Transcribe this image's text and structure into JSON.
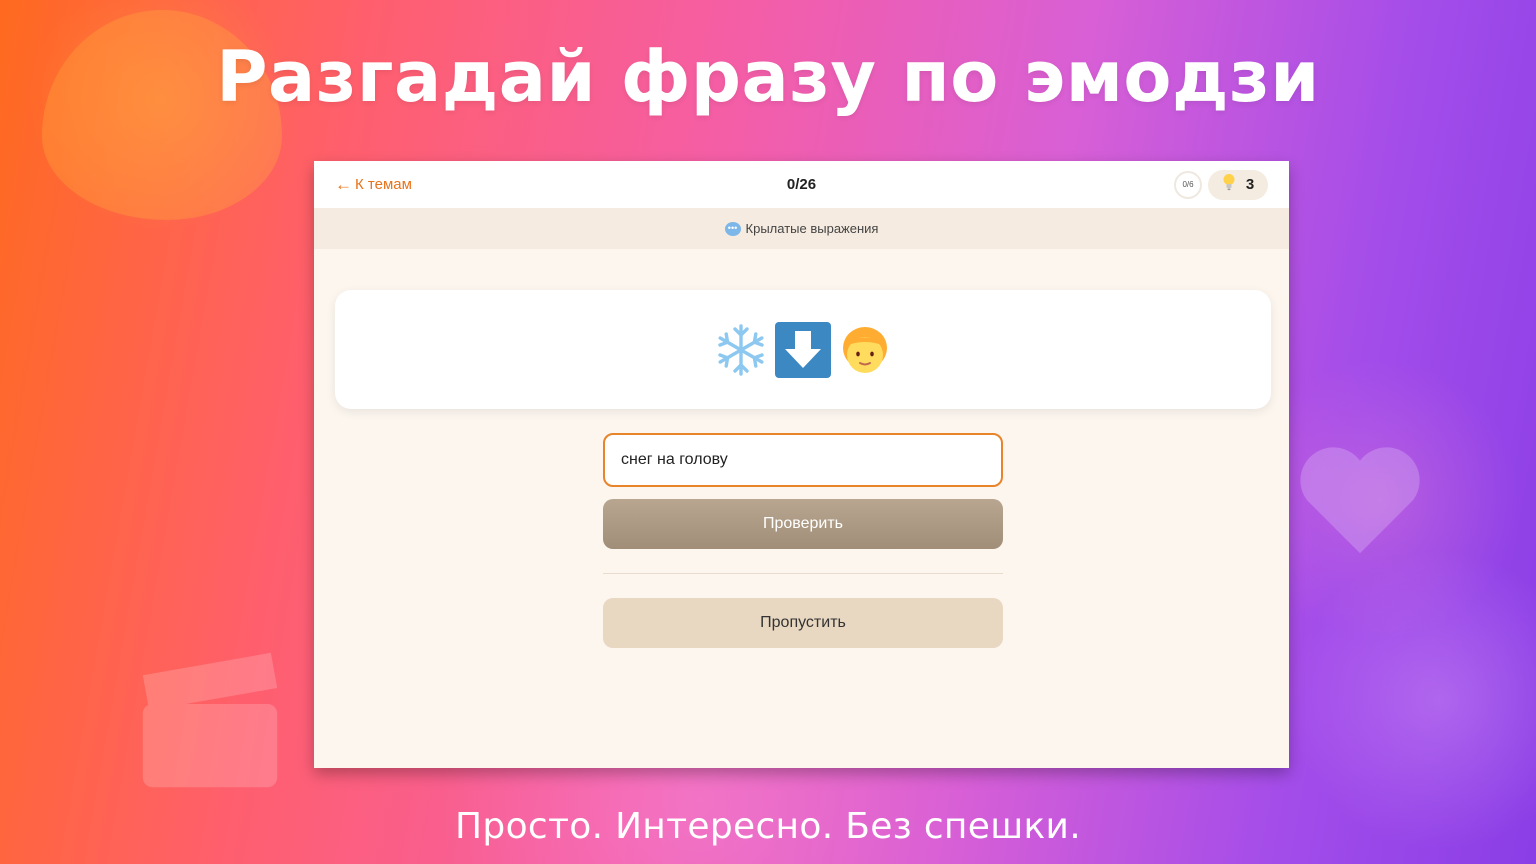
{
  "banner": {
    "headline": "Разгадай фразу по эмодзи",
    "tagline": "Просто. Интересно. Без спешки."
  },
  "topbar": {
    "back_arrow": "←",
    "back_label": "К темам",
    "progress": "0/26",
    "score": "0/6",
    "hints_count": "3",
    "hints_icon": "lightbulb-icon"
  },
  "topic": {
    "icon": "speech-bubble-icon",
    "label": "Крылатые выражения"
  },
  "puzzle": {
    "emojis": [
      "snowflake-icon",
      "down-arrow-icon",
      "person-icon"
    ]
  },
  "answer": {
    "value": "снег на голову"
  },
  "actions": {
    "check_label": "Проверить",
    "skip_label": "Пропустить"
  },
  "colors": {
    "accent": "#e8731a",
    "input_border": "#e8842a",
    "check_button": "#a18e78",
    "skip_button": "#e8d7c1"
  }
}
